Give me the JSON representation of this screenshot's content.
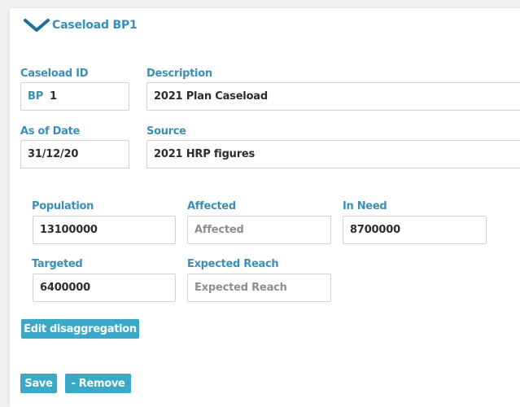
{
  "header": {
    "title": "Caseload BP1",
    "icon": "chevron-down-icon"
  },
  "caseload": {
    "id_label": "Caseload ID",
    "id_prefix": "BP",
    "id_value": "1",
    "description_label": "Description",
    "description_value": "2021 Plan Caseload",
    "as_of_date_label": "As of Date",
    "as_of_date_value": "31/12/20",
    "source_label": "Source",
    "source_value": "2021 HRP figures"
  },
  "figures": {
    "population_label": "Population",
    "population_value": "13100000",
    "affected_label": "Affected",
    "affected_placeholder": "Affected",
    "in_need_label": "In Need",
    "in_need_value": "8700000",
    "targeted_label": "Targeted",
    "targeted_value": "6400000",
    "expected_reach_label": "Expected Reach",
    "expected_reach_placeholder": "Expected Reach"
  },
  "actions": {
    "edit_disaggregation_label": "Edit disaggregation",
    "save_label": "Save",
    "remove_label": "- Remove"
  },
  "colors": {
    "accent": "#3a8fb7",
    "button": "#3ba8c8"
  }
}
